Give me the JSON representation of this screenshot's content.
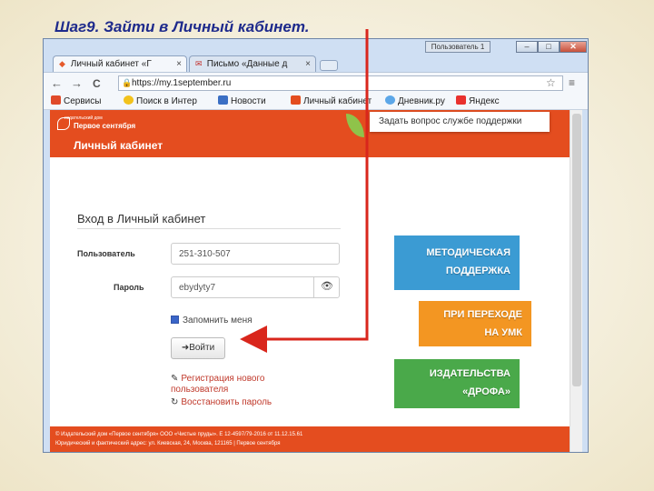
{
  "slide": {
    "title": "Шаг9. Зайти в Личный кабинет."
  },
  "window": {
    "user_badge": "Пользователь 1",
    "min_glyph": "–",
    "max_glyph": "□",
    "close_glyph": "✕"
  },
  "tabs": [
    {
      "label": "Личный кабинет «Г",
      "close": "×"
    },
    {
      "label": "Письмо «Данные д",
      "close": "×"
    }
  ],
  "toolbar": {
    "back": "←",
    "forward": "→",
    "reload": "C",
    "url": "https://my.1september.ru",
    "lock_glyph": "🔒",
    "star": "☆",
    "menu": "≡"
  },
  "bookmarks": [
    {
      "label": "Сервисы",
      "color": "#e04a2a"
    },
    {
      "label": "Поиск в Интер",
      "color": "#f2c21c"
    },
    {
      "label": "Новости",
      "color": "#3b6fc4"
    },
    {
      "label": "Личный кабинет",
      "color": "#e44d1f"
    },
    {
      "label": "Дневник.ру",
      "color": "#5ca7e8"
    },
    {
      "label": "Яндекс",
      "color": "#e9312e"
    }
  ],
  "site": {
    "logo_tag": "издательский дом",
    "logo_name_1": "Первое",
    "logo_name_2": "сентября",
    "header_title": "Личный кабинет",
    "support_link": "Задать вопрос службе поддержки",
    "brand_color": "#e44d1f"
  },
  "login": {
    "heading": "Вход в Личный кабинет",
    "user_label": "Пользователь",
    "user_value": "251-310-507",
    "password_label": "Пароль",
    "password_value": "ebydyty7",
    "eye_glyph": "👁",
    "remember_label": "Запомнить меня",
    "remember_checked": true,
    "submit_label": "Войти",
    "submit_glyph": "➜",
    "register_line1": "Регистрация нового",
    "register_line2": "пользователя",
    "restore_label": "Восстановить пароль",
    "register_glyph": "✎",
    "restore_glyph": "↻"
  },
  "banners": [
    {
      "line1": "МЕТОДИЧЕСКАЯ",
      "line2": "ПОДДЕРЖКА",
      "color": "#3b9bd3"
    },
    {
      "line1": "ПРИ ПЕРЕХОДЕ",
      "line2": "НА УМК",
      "color": "#f39622"
    },
    {
      "line1": "ИЗДАТЕЛЬСТВА",
      "line2": "«ДРОФА»",
      "color": "#4aa94a"
    }
  ],
  "footer": {
    "line1": "© Издательский дом «Первое сентября» ООО «Чистые пруды». Е 12-4597/79-2016 от 11.12.15.61",
    "line2": "Юридический и фактический адрес: ул. Киевская, 24, Москва, 121165 | Первое сентября"
  },
  "annotation": {
    "arrow_color": "#d9261c"
  }
}
